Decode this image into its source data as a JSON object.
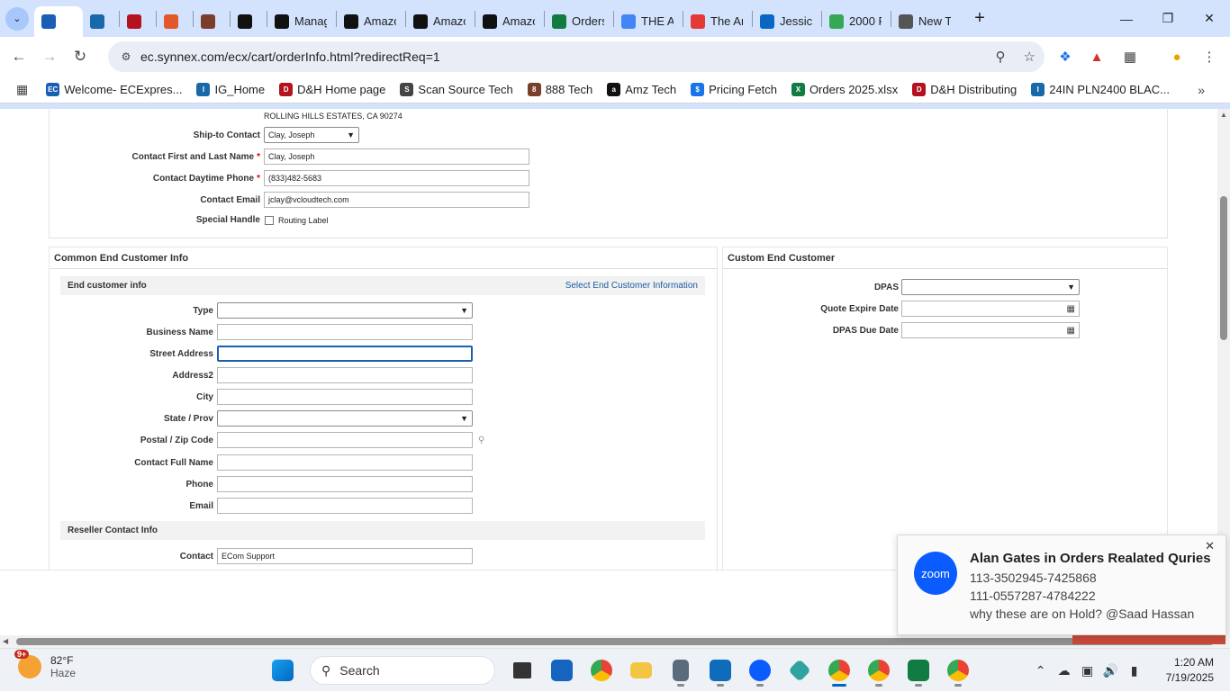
{
  "browser": {
    "tabs": [
      {
        "title": "",
        "favicon": "ec-icon",
        "color": "#1a5fb4",
        "active": true
      },
      {
        "title": "",
        "favicon": "ingram-icon",
        "color": "#1769aa"
      },
      {
        "title": "",
        "favicon": "dh-icon",
        "color": "#b3121e"
      },
      {
        "title": "",
        "favicon": "s-icon",
        "color": "#e2582b"
      },
      {
        "title": "",
        "favicon": "888-icon",
        "color": "#7a3e2b"
      },
      {
        "title": "",
        "favicon": "amazon-icon",
        "color": "#111111"
      },
      {
        "title": "Manag",
        "favicon": "amazon-icon",
        "color": "#111111"
      },
      {
        "title": "Amazo",
        "favicon": "amazon-icon",
        "color": "#111111"
      },
      {
        "title": "Amazo",
        "favicon": "amazon-icon",
        "color": "#111111"
      },
      {
        "title": "Amazo",
        "favicon": "amazon-icon",
        "color": "#111111"
      },
      {
        "title": "Orders",
        "favicon": "excel-icon",
        "color": "#107c41"
      },
      {
        "title": "THE AI",
        "favicon": "google-icon",
        "color": "#4285f4"
      },
      {
        "title": "The Ar",
        "favicon": "arrow-icon",
        "color": "#e53935"
      },
      {
        "title": "Jessica",
        "favicon": "linkedin-icon",
        "color": "#0a66c2"
      },
      {
        "title": "2000 P",
        "favicon": "maps-icon",
        "color": "#34a853"
      },
      {
        "title": "New Ta",
        "favicon": "chrome-icon",
        "color": "#555555"
      }
    ],
    "url": "ec.synnex.com/ecx/cart/orderInfo.html?redirectReq=1",
    "bookmarks": [
      {
        "label": "Welcome- ECExpres...",
        "color": "#1a5fb4",
        "icon": "EC"
      },
      {
        "label": "IG_Home",
        "color": "#1769aa",
        "icon": "I"
      },
      {
        "label": "D&H Home page",
        "color": "#b3121e",
        "icon": "D"
      },
      {
        "label": "Scan Source Tech",
        "color": "#444444",
        "icon": "S"
      },
      {
        "label": "888 Tech",
        "color": "#7a3e2b",
        "icon": "8"
      },
      {
        "label": "Amz Tech",
        "color": "#111111",
        "icon": "a"
      },
      {
        "label": "Pricing Fetch",
        "color": "#1a73e8",
        "icon": "$"
      },
      {
        "label": "Orders 2025.xlsx",
        "color": "#107c41",
        "icon": "X"
      },
      {
        "label": "D&H Distributing",
        "color": "#b3121e",
        "icon": "D"
      },
      {
        "label": "24IN PLN2400 BLAC...",
        "color": "#1769aa",
        "icon": "I"
      }
    ]
  },
  "shipto": {
    "address_line": "ROLLING HILLS ESTATES, CA 90274",
    "ship_to_contact_label": "Ship-to Contact",
    "ship_to_contact_value": "Clay, Joseph",
    "contact_name_label": "Contact First and Last Name",
    "contact_name_value": "Clay, Joseph",
    "phone_label": "Contact Daytime Phone",
    "phone_value": "(833)482-5683",
    "email_label": "Contact Email",
    "email_value": "jclay@vcloudtech.com",
    "special_handle_label": "Special Handle",
    "routing_label": "Routing Label",
    "required_mark": "*"
  },
  "common_end_customer": {
    "title": "Common End Customer Info",
    "subhead": "End customer info",
    "select_link": "Select End Customer Information",
    "fields": {
      "type": "Type",
      "business_name": "Business Name",
      "street_address": "Street Address",
      "address2": "Address2",
      "city": "City",
      "state": "State / Prov",
      "postal": "Postal / Zip Code",
      "contact_full_name": "Contact Full Name",
      "phone": "Phone",
      "email": "Email"
    },
    "reseller_subhead": "Reseller Contact Info",
    "contact_label": "Contact",
    "contact_value": "ECom Support"
  },
  "custom_end_customer": {
    "title": "Custom End Customer",
    "dpas_label": "DPAS",
    "quote_expire_label": "Quote Expire Date",
    "dpas_due_label": "DPAS Due Date"
  },
  "toast": {
    "app": "zoom",
    "title": "Alan Gates in Orders Realated Quries",
    "lines": [
      "113-3502945-7425868",
      "111-0557287-4784222",
      "why these are on Hold? @Saad Hassan"
    ]
  },
  "taskbar": {
    "weather_temp": "82°F",
    "weather_desc": "Haze",
    "weather_badge": "9+",
    "search_placeholder": "Search",
    "time": "1:20 AM",
    "date": "7/19/2025"
  }
}
